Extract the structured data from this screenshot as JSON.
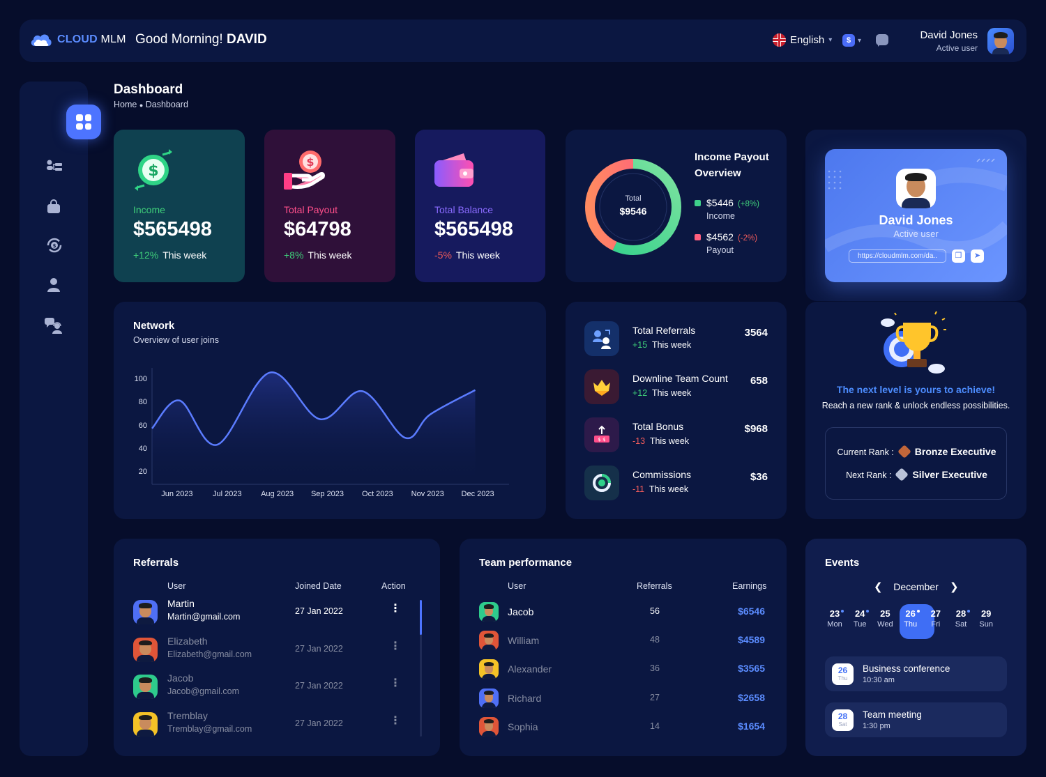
{
  "brand": {
    "name_part1": "CLOUD",
    "name_part2": "MLM"
  },
  "header": {
    "greeting": "Good Morning!",
    "greeting_name": "DAVID",
    "language": "English",
    "currency_symbol": "$",
    "user_name": "David Jones",
    "user_status": "Active user"
  },
  "sidebar": {
    "items": [
      {
        "name": "dashboard",
        "icon": "dashboard-grid-icon",
        "active": true
      },
      {
        "name": "network",
        "icon": "network-tree-icon"
      },
      {
        "name": "shop",
        "icon": "shopping-bag-icon"
      },
      {
        "name": "payout",
        "icon": "currency-exchange-icon"
      },
      {
        "name": "profile",
        "icon": "user-icon"
      },
      {
        "name": "support",
        "icon": "support-chat-icon"
      }
    ]
  },
  "page": {
    "title": "Dashboard",
    "breadcrumb_home": "Home",
    "breadcrumb_current": "Dashboard"
  },
  "stats_cards": [
    {
      "label": "Income",
      "value": "$565498",
      "delta": "+12%",
      "period": "This week",
      "color": "#3fcf7a"
    },
    {
      "label": "Total Payout",
      "value": "$64798",
      "delta": "+8%",
      "period": "This week",
      "color": "#ff4f8b"
    },
    {
      "label": "Total Balance",
      "value": "$565498",
      "delta": "-5%",
      "period": "This week",
      "color": "#8a5cff"
    }
  ],
  "overview": {
    "title_line1": "Income Payout",
    "title_line2": "Overview",
    "donut_label": "Total",
    "donut_value": "$9546",
    "income_value": "$5446",
    "income_change": "(+8%)",
    "income_label": "Income",
    "income_share": 0.57,
    "payout_value": "$4562",
    "payout_change": "(-2%)",
    "payout_label": "Payout",
    "payout_share": 0.43,
    "income_color": "#3fd08a",
    "payout_color": "#ff5f7e"
  },
  "profile": {
    "name": "David Jones",
    "status": "Active user",
    "link": "https://cloudmlm.com/da..",
    "copy_icon": "copy-icon",
    "share_icon": "send-icon"
  },
  "network": {
    "title": "Network",
    "subtitle": "Overview of  user joins"
  },
  "chart_data": {
    "type": "line",
    "x": [
      "Jun 2023",
      "Jul 2023",
      "Aug 2023",
      "Sep 2023",
      "Oct 2023",
      "Nov 2023",
      "Dec 2023"
    ],
    "y_ticks": [
      100,
      80,
      60,
      40,
      20
    ],
    "ylim": [
      10,
      110
    ],
    "points": [
      {
        "x": 0.0,
        "y": 58
      },
      {
        "x": 0.55,
        "y": 82
      },
      {
        "x": 1.3,
        "y": 44
      },
      {
        "x": 2.35,
        "y": 106
      },
      {
        "x": 3.35,
        "y": 66
      },
      {
        "x": 4.2,
        "y": 90
      },
      {
        "x": 5.05,
        "y": 50
      },
      {
        "x": 5.55,
        "y": 70
      },
      {
        "x": 6.45,
        "y": 91
      }
    ],
    "line_color": "#5b7cff",
    "grid": false
  },
  "stats_list": [
    {
      "label": "Total Referrals",
      "delta": "+15",
      "period": "This week",
      "value": "3564",
      "icon": "referrals-icon",
      "bg": "#14306a"
    },
    {
      "label": "Downline Team Count",
      "delta": "+12",
      "period": "This week",
      "value": "658",
      "icon": "team-crown-icon",
      "bg": "#3a1a33"
    },
    {
      "label": "Total Bonus",
      "delta": "-13",
      "period": "This week",
      "value": "$968",
      "icon": "bonus-icon",
      "bg": "#2d1a4a"
    },
    {
      "label": "Commissions",
      "delta": "-11",
      "period": "This week",
      "value": "$36",
      "icon": "commission-icon",
      "bg": "#15304a"
    }
  ],
  "rank": {
    "title": "The next level is yours to achieve!",
    "subtitle": "Reach a new rank & unlock endless possibilities.",
    "current_label": "Current Rank :",
    "current_value": "Bronze Executive",
    "next_label": "Next Rank :",
    "next_value": "Silver Executive"
  },
  "referrals": {
    "title": "Referrals",
    "columns": [
      "User",
      "Joined Date",
      "Action"
    ],
    "rows": [
      {
        "name": "Martin",
        "email": "Martin@gmail.com",
        "date": "27 Jan 2022",
        "bg": "#4f6ff5"
      },
      {
        "name": "Elizabeth",
        "email": "Elizabeth@gmail.com",
        "date": "27 Jan 2022",
        "bg": "#e05538"
      },
      {
        "name": "Jacob",
        "email": "Jacob@gmail.com",
        "date": "27 Jan 2022",
        "bg": "#2ecb8c"
      },
      {
        "name": "Tremblay",
        "email": "Tremblay@gmail.com",
        "date": "27 Jan 2022",
        "bg": "#f4c227"
      }
    ]
  },
  "team": {
    "title": "Team performance",
    "columns": [
      "User",
      "Referrals",
      "Earnings"
    ],
    "rows": [
      {
        "name": "Jacob",
        "referrals": "56",
        "earnings": "$6546",
        "bg": "#2ecb8c"
      },
      {
        "name": "William",
        "referrals": "48",
        "earnings": "$4589",
        "bg": "#e05538"
      },
      {
        "name": "Alexander",
        "referrals": "36",
        "earnings": "$3565",
        "bg": "#f4c227"
      },
      {
        "name": "Richard",
        "referrals": "27",
        "earnings": "$2658",
        "bg": "#4f6ff5"
      },
      {
        "name": "Sophia",
        "referrals": "14",
        "earnings": "$1654",
        "bg": "#e05538"
      }
    ]
  },
  "events": {
    "title": "Events",
    "month": "December",
    "days": [
      {
        "n": "23",
        "w": "Mon",
        "dot": true
      },
      {
        "n": "24",
        "w": "Tue",
        "dot": true
      },
      {
        "n": "25",
        "w": "Wed",
        "dot": false
      },
      {
        "n": "26",
        "w": "Thu",
        "dot": true,
        "active": true
      },
      {
        "n": "27",
        "w": "Fri",
        "dot": false
      },
      {
        "n": "28",
        "w": "Sat",
        "dot": true
      },
      {
        "n": "29",
        "w": "Sun",
        "dot": false
      }
    ],
    "items": [
      {
        "day": "26",
        "weekday": "Thu",
        "name": "Business conference",
        "time": "10:30 am"
      },
      {
        "day": "28",
        "weekday": "Sat",
        "name": "Team meeting",
        "time": "1:30 pm"
      }
    ]
  }
}
